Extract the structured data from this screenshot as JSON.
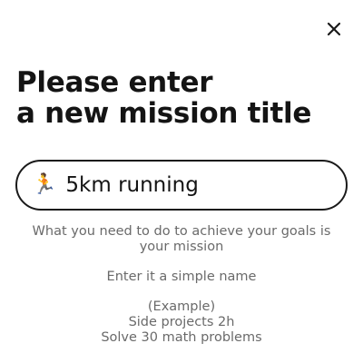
{
  "header": {
    "close_icon": "close-icon"
  },
  "title": {
    "line1": "Please enter",
    "line2": "a new mission title"
  },
  "mission_input": {
    "icon": "runner-emoji",
    "value": "5km running"
  },
  "guidance": {
    "description": "What you need to do to achieve your goals is your mission",
    "instruction": "Enter it a simple name",
    "example_heading": "(Example)",
    "example_1": "Side projects 2h",
    "example_2": "Solve 30 math problems"
  }
}
